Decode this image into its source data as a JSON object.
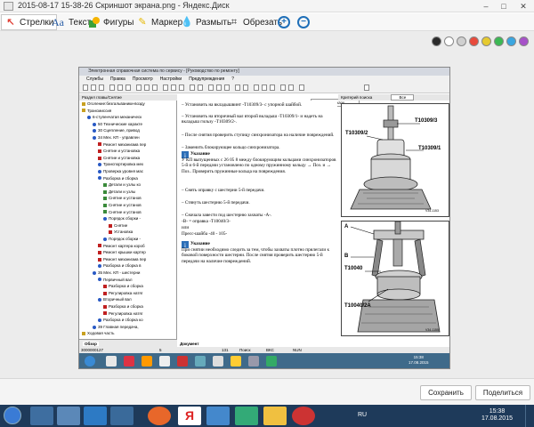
{
  "window": {
    "title": "2015-08-17 15-38-26 Скриншот экрана.png - Яндекс.Диск"
  },
  "toolbar": {
    "arrows": "Стрелки",
    "text": "Текст",
    "shapes": "Фигуры",
    "marker": "Маркер",
    "blur": "Размыть",
    "crop": "Обрезать"
  },
  "palette": [
    "#2b2b2b",
    "#ffffff",
    "#cfcfcf",
    "#e84a3c",
    "#e6ca2f",
    "#3cb854",
    "#3aa6e0",
    "#a651c8"
  ],
  "app": {
    "title": "Электронная справочная система по сервису - [Руководство по ремонту]",
    "menu": [
      "Службы",
      "Правка",
      "Просмотр",
      "Настройки",
      "Предупреждения",
      "?"
    ],
    "notes_label": "Заметка к заказу",
    "tree_header": "Раздел главы/Снятие",
    "right_header": "Критерий поиска",
    "right_header2": "Все",
    "tree": [
      "Оголение:безгальваники-возду",
      "Трансмиссия",
      "6-ступенчатая механическ",
      "50 Технические характе",
      "30 Сцепление, привод",
      "34 Мех. КП - управлен",
      "Ремонт механизма пер",
      "Снятие и установка",
      "Снятие и установка",
      "Транспортировка мех",
      "Проверка уровня мас",
      "Разборка и сборка",
      "Детали и узлы ко",
      "Детали и узлы",
      "Снятие и установ",
      "Снятие и установ",
      "Снятие и установ",
      "Порядок сборки -",
      "Снятие",
      "Установка",
      "Порядок сборки -",
      "Ремонт картера короб",
      "Ремонт крышки картер",
      "Ремонт механизма пер",
      "Разборка и сборка в",
      "35 Мех. КП - шестерни",
      "Первичный вал",
      "Разборка и сборка",
      "Регулировка натяг",
      "Вторичный вал",
      "Разборка и сборка",
      "Регулировка натяг",
      "Разборка и сборка ко",
      "39 Главная передача,",
      "Ходовая часть"
    ],
    "tabs": [
      "Обзор",
      "Документ"
    ],
    "status": [
      "3000000127",
      "5",
      "131",
      "Поиск",
      "ВКС",
      "NUN"
    ],
    "content": [
      "– Установить на вкладышвинт -T10309/3- с упорной шайбой.",
      "– Установить на вторичный вал второй вкладыш -T10309/1- и надеть на вкладыш гильзу -T10309/2-.",
      "– После снятия проверить ступицу синхронизатора на наличие повреждений.",
      "– Заменить блокирующее кольцо синхронизатора.",
      "Указание",
      "У КП выпущенных с 26 05 8 между блокирующим кольцами синхронизаторов 5-й и 6-й передачи установлено по одному пружинному кольцу → Поз. и → Поз.. Проверить пружинные кольца на повреждения.",
      "– Снять оправку с шестерни 5-й передачи.",
      "– Стянуть шестерню 5-й передачи.",
      "– Сначала завести под шестерню захваты -A-.",
      "-B- = оправка -T10040/3-",
      "или",
      "Пресс-шайба -40 - 105-",
      "Указание",
      "При снятии необходимо следить за тем, чтобы захваты плотно прилегали к боковой поверхности шестерни. После снятия проверить шестерню 5-й передачи на наличие повреждений."
    ],
    "figure1": {
      "labels": [
        "T10309/3",
        "T10309/2",
        "T10309/1"
      ],
      "code": "V34-1153"
    },
    "figure2": {
      "labels": [
        "A",
        "B",
        "T10040",
        "T10040/2A"
      ],
      "code": "V34-1155"
    },
    "clock": {
      "time": "15:38",
      "date": "17.08.2015"
    }
  },
  "buttons": {
    "save": "Сохранить",
    "share": "Поделиться"
  },
  "taskbar": {
    "lang": "RU",
    "time": "15:38",
    "date": "17.08.2015"
  }
}
